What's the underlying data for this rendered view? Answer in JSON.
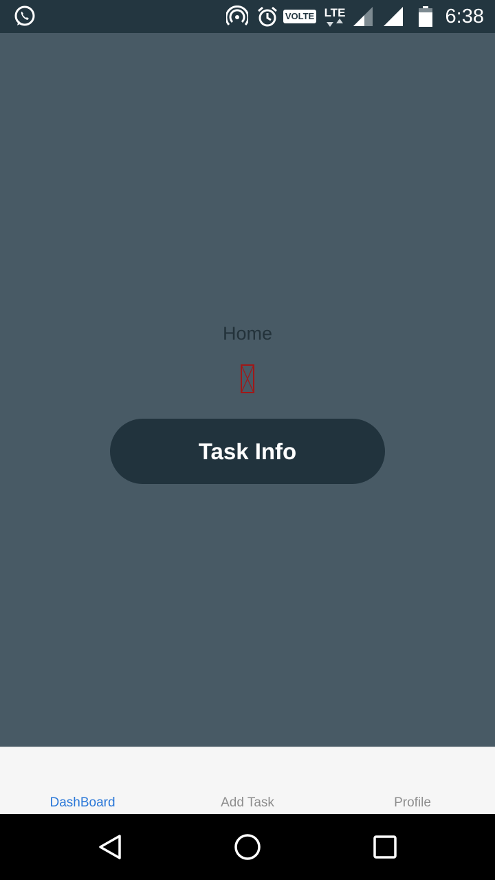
{
  "status_bar": {
    "time": "6:38",
    "volte": "VOLTE",
    "lte": "LTE",
    "icons": [
      "whatsapp-icon",
      "hotspot-icon",
      "alarm-icon",
      "volte-icon",
      "lte-data-icon",
      "signal-icon",
      "signal-icon",
      "battery-icon"
    ]
  },
  "main": {
    "title": "Home",
    "task_button_label": "Task Info"
  },
  "tab_bar": {
    "tabs": [
      {
        "label": "DashBoard",
        "active": true
      },
      {
        "label": "Add Task",
        "active": false
      },
      {
        "label": "Profile",
        "active": false
      }
    ],
    "active_color": "#2b78d8",
    "inactive_color": "#8e8e8e"
  },
  "colors": {
    "background": "#485a65",
    "status_bar": "#233640",
    "button": "#21333d"
  },
  "nav_bar": {
    "icons": [
      "back-icon",
      "home-icon",
      "recents-icon"
    ]
  }
}
